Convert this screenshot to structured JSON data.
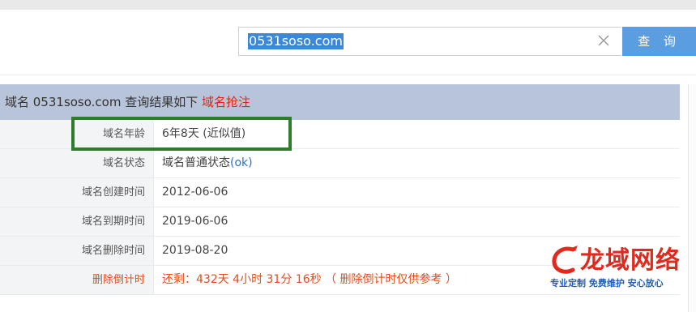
{
  "search": {
    "value": "0531soso.com",
    "button_label": "查 询"
  },
  "result": {
    "header_prefix": "域名 0531soso.com 查询结果如下",
    "header_link": "域名抢注",
    "rows": [
      {
        "label": "域名年龄",
        "value": "6年8天 (近似值)"
      },
      {
        "label": "域名状态",
        "value": "域名普通状态",
        "value_extra": "(ok)"
      },
      {
        "label": "域名创建时间",
        "value": "2012-06-06"
      },
      {
        "label": "域名到期时间",
        "value": "2019-06-06"
      },
      {
        "label": "域名删除时间",
        "value": "2019-08-20"
      },
      {
        "label": "删除倒计时",
        "value": "还剩：432天 4小时 31分 16秒 （ 删除倒计时仅供参考 ）"
      }
    ]
  },
  "watermark": {
    "title": "龙域网络",
    "subtitle": "专业定制 免费维护 安心放心"
  },
  "colors": {
    "header_bg": "#b8c4da",
    "accent_red": "#e0231a",
    "button_blue": "#5a9de0",
    "highlight_green": "#2e7d2a"
  },
  "icons": [
    "clear-x-icon",
    "dragon-logo-icon"
  ]
}
